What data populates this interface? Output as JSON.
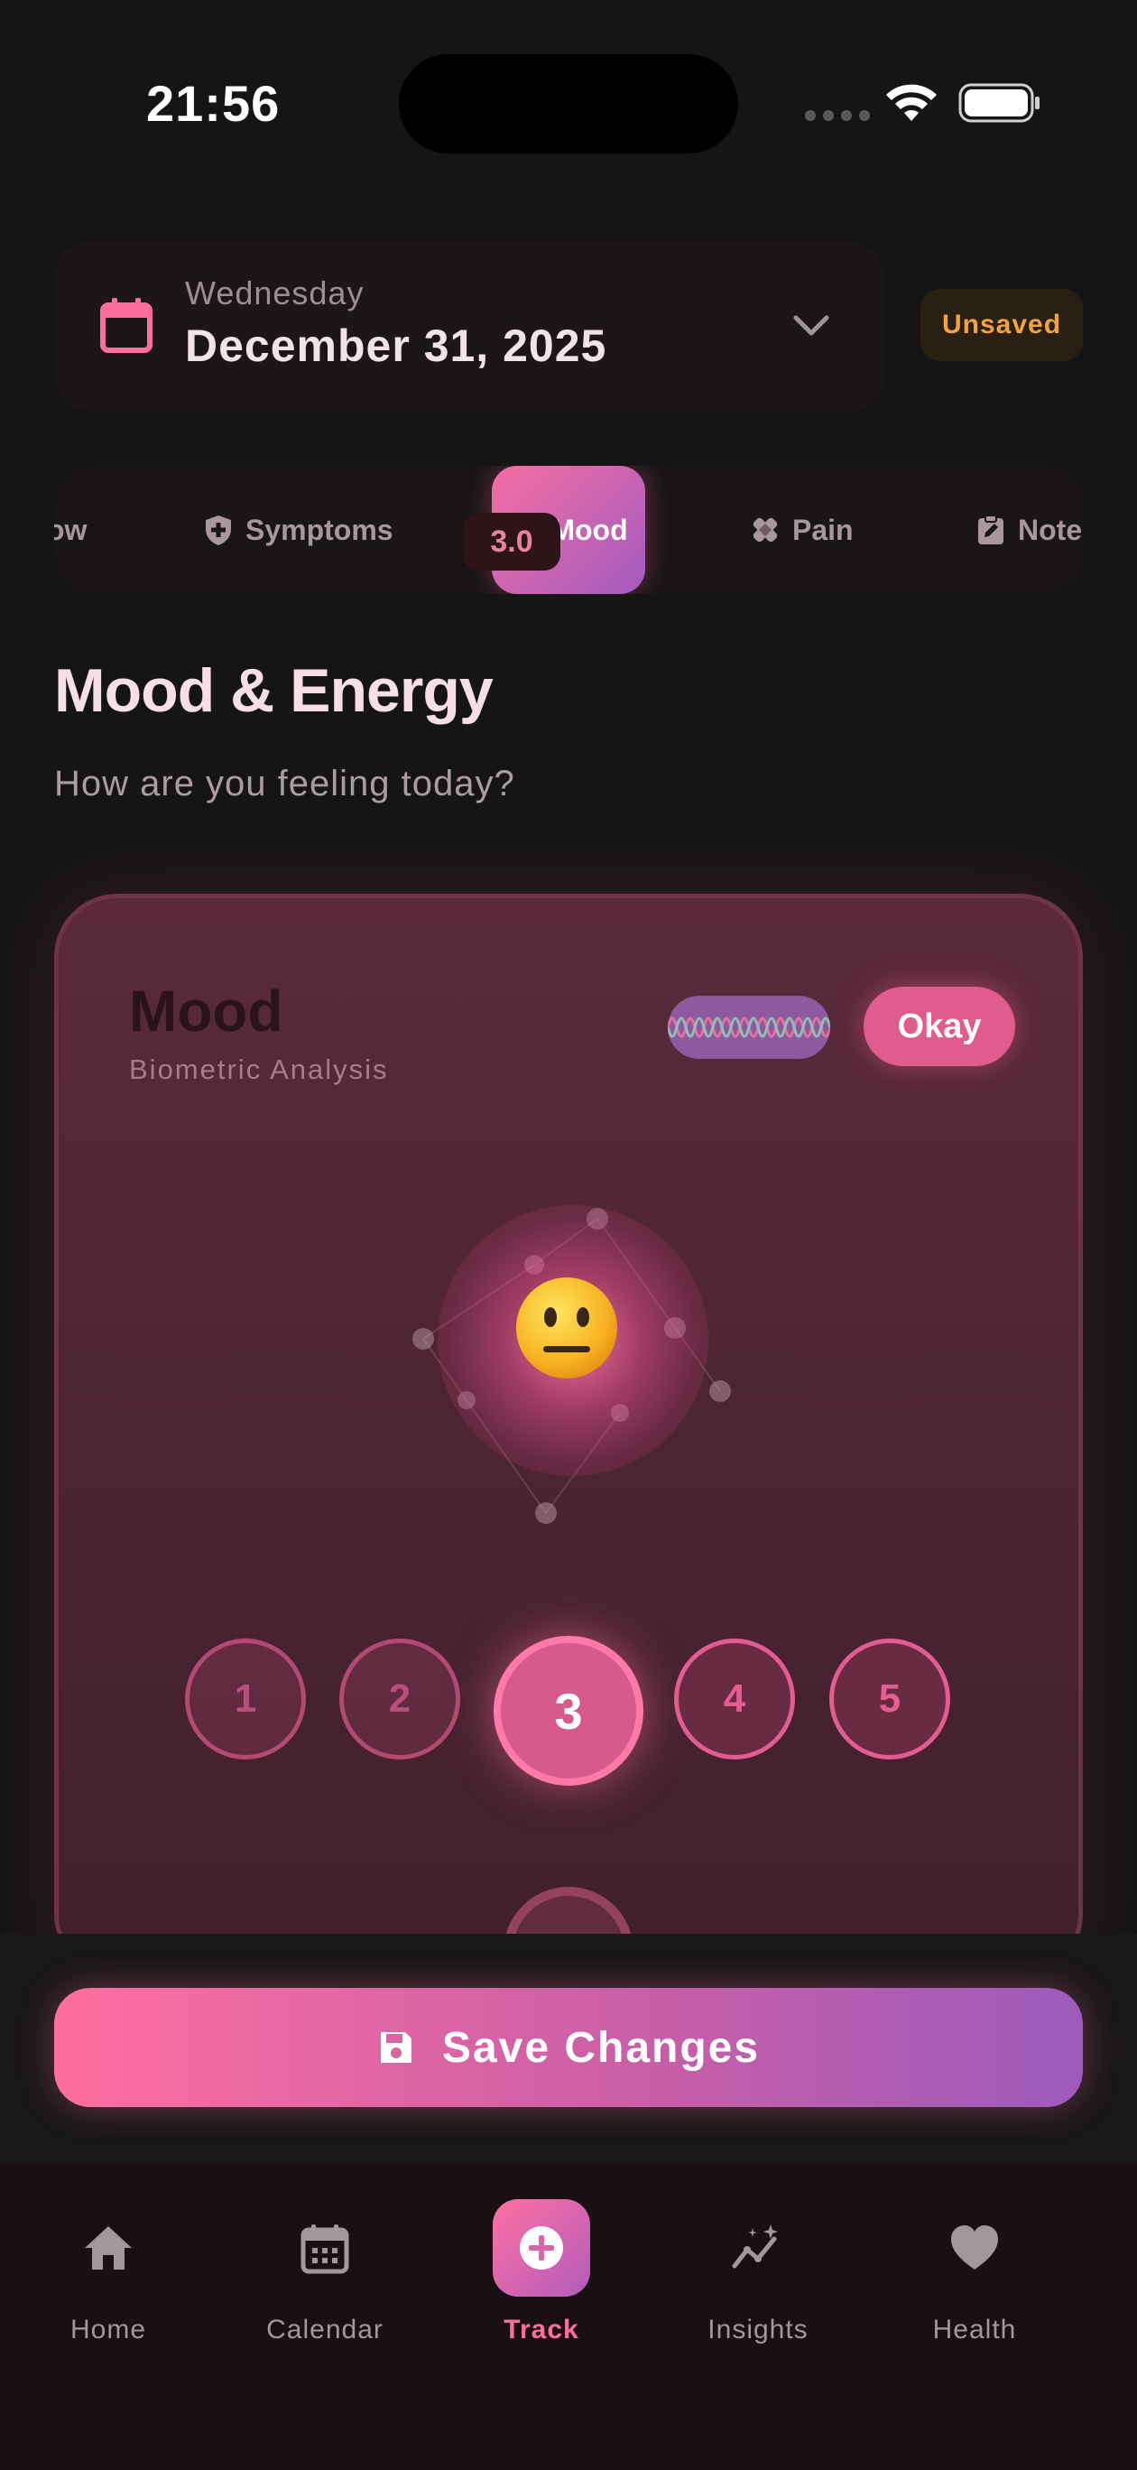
{
  "status_bar": {
    "time": "21:56"
  },
  "date_header": {
    "weekday": "Wednesday",
    "date": "December 31, 2025",
    "unsaved_label": "Unsaved"
  },
  "tabs": [
    {
      "label": "ow",
      "icon": "flow-icon"
    },
    {
      "label": "Symptoms",
      "icon": "shield-plus-icon"
    },
    {
      "label": "Mood",
      "icon": "smile-icon",
      "active": true
    },
    {
      "label": "Pain",
      "icon": "bandage-icon"
    },
    {
      "label": "Note",
      "icon": "clipboard-edit-icon"
    }
  ],
  "section": {
    "title": "Mood & Energy",
    "subtitle": "How are you feeling today?"
  },
  "mood_card": {
    "title": "Mood",
    "subtitle": "Biometric Analysis",
    "status_label": "Okay",
    "score": "3.0",
    "scale": [
      "1",
      "2",
      "3",
      "4",
      "5"
    ],
    "selected_value": 3
  },
  "save_button": {
    "label": "Save Changes"
  },
  "bottom_nav": [
    {
      "label": "Home",
      "icon": "home-icon"
    },
    {
      "label": "Calendar",
      "icon": "calendar-icon"
    },
    {
      "label": "Track",
      "icon": "plus-circle-icon",
      "active": true
    },
    {
      "label": "Insights",
      "icon": "sparkle-chart-icon"
    },
    {
      "label": "Health",
      "icon": "heart-icon"
    }
  ],
  "colors": {
    "accent_pink": "#ff6ea0",
    "accent_purple": "#9c5bbd",
    "warning_orange": "#f3a33a",
    "background": "#151515"
  }
}
